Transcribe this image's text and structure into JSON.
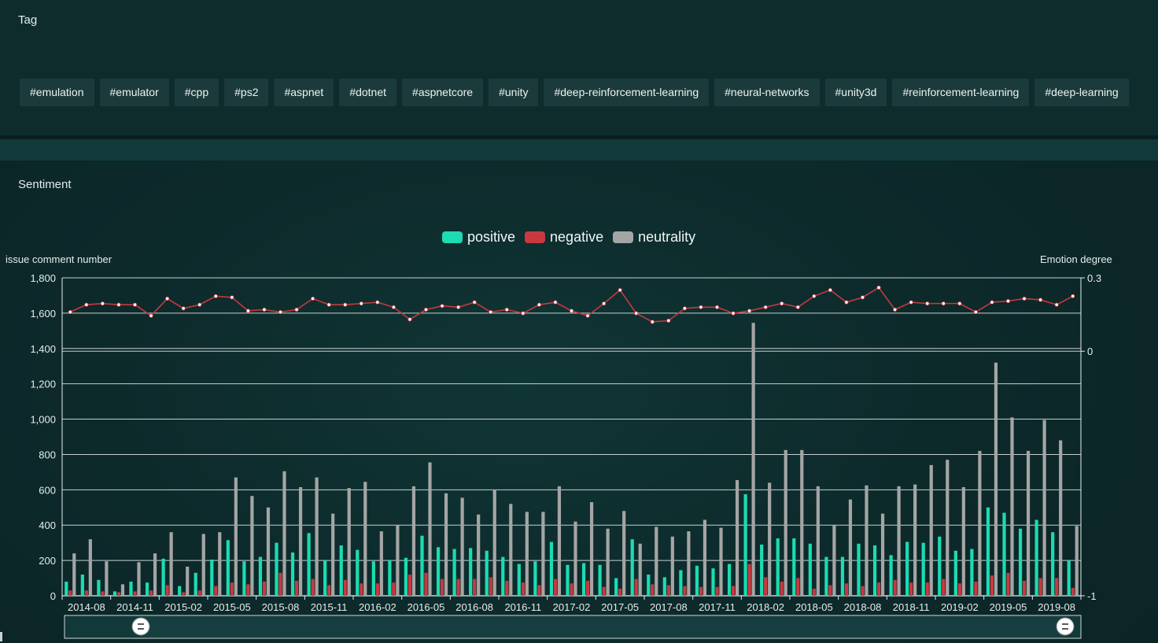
{
  "tag_section": {
    "title": "Tag",
    "tags": [
      "#emulation",
      "#emulator",
      "#cpp",
      "#ps2",
      "#aspnet",
      "#dotnet",
      "#aspnetcore",
      "#unity",
      "#deep-reinforcement-learning",
      "#neural-networks",
      "#unity3d",
      "#reinforcement-learning",
      "#deep-learning"
    ]
  },
  "sentiment_section": {
    "title": "Sentiment"
  },
  "colors": {
    "positive": "#1bdcb2",
    "negative": "#c8393f",
    "neutrality": "#a5a5a5",
    "line": "#c8393f",
    "grid": "#e6eded"
  },
  "chart_data": {
    "type": "bar",
    "legend_position": "top-center",
    "ylabel": "issue comment number",
    "y2label": "Emotion degree",
    "ylim": [
      0,
      1800
    ],
    "yticks": [
      "0",
      "200",
      "400",
      "600",
      "800",
      "1,000",
      "1,200",
      "1,400",
      "1,600",
      "1,800"
    ],
    "y2lim": [
      -1,
      0.3
    ],
    "y2ticks": [
      "-1",
      "0",
      "0.3"
    ],
    "x_labels": [
      "2014-08",
      "2014-11",
      "2015-02",
      "2015-05",
      "2015-08",
      "2015-11",
      "2016-02",
      "2016-05",
      "2016-08",
      "2016-11",
      "2017-02",
      "2017-05",
      "2017-08",
      "2017-11",
      "2018-02",
      "2018-05",
      "2018-08",
      "2018-11",
      "2019-02",
      "2019-05",
      "2019-08"
    ],
    "months_count": 63,
    "series": [
      {
        "name": "positive",
        "values": [
          80,
          120,
          90,
          25,
          80,
          75,
          210,
          55,
          130,
          205,
          315,
          195,
          220,
          300,
          245,
          355,
          200,
          285,
          260,
          195,
          200,
          215,
          340,
          275,
          265,
          270,
          255,
          220,
          180,
          195,
          305,
          175,
          185,
          175,
          100,
          320,
          120,
          105,
          145,
          170,
          155,
          180,
          575,
          290,
          325,
          325,
          295,
          220,
          220,
          295,
          285,
          230,
          305,
          300,
          335,
          255,
          265,
          500,
          470,
          380,
          430,
          360,
          200
        ]
      },
      {
        "name": "negative",
        "values": [
          30,
          30,
          25,
          20,
          25,
          30,
          60,
          20,
          30,
          55,
          75,
          65,
          80,
          130,
          85,
          95,
          60,
          90,
          70,
          70,
          75,
          120,
          130,
          95,
          95,
          95,
          105,
          85,
          75,
          60,
          95,
          70,
          85,
          50,
          40,
          95,
          65,
          60,
          55,
          50,
          50,
          55,
          180,
          105,
          80,
          100,
          40,
          60,
          70,
          55,
          75,
          90,
          75,
          75,
          95,
          70,
          80,
          115,
          130,
          85,
          100,
          100,
          45
        ]
      },
      {
        "name": "neutrality",
        "values": [
          240,
          320,
          195,
          65,
          190,
          240,
          360,
          165,
          350,
          360,
          670,
          565,
          500,
          705,
          615,
          670,
          465,
          610,
          645,
          365,
          400,
          620,
          755,
          580,
          555,
          460,
          600,
          520,
          475,
          475,
          620,
          420,
          530,
          380,
          480,
          295,
          390,
          335,
          365,
          430,
          385,
          655,
          1545,
          640,
          825,
          825,
          620,
          400,
          545,
          625,
          465,
          620,
          630,
          740,
          770,
          615,
          820,
          1320,
          1010,
          820,
          995,
          880,
          395
        ]
      },
      {
        "name": "emotion degree",
        "axis": "right",
        "values": [
          0.16,
          0.19,
          0.195,
          0.19,
          0.19,
          0.145,
          0.215,
          0.175,
          0.19,
          0.225,
          0.22,
          0.165,
          0.17,
          0.16,
          0.17,
          0.215,
          0.19,
          0.19,
          0.195,
          0.2,
          0.18,
          0.13,
          0.17,
          0.185,
          0.18,
          0.2,
          0.16,
          0.17,
          0.155,
          0.19,
          0.2,
          0.165,
          0.145,
          0.195,
          0.25,
          0.155,
          0.12,
          0.125,
          0.175,
          0.18,
          0.18,
          0.155,
          0.165,
          0.18,
          0.195,
          0.18,
          0.225,
          0.25,
          0.2,
          0.22,
          0.26,
          0.17,
          0.2,
          0.195,
          0.195,
          0.195,
          0.16,
          0.2,
          0.205,
          0.215,
          0.21,
          0.19,
          0.225
        ]
      }
    ]
  }
}
